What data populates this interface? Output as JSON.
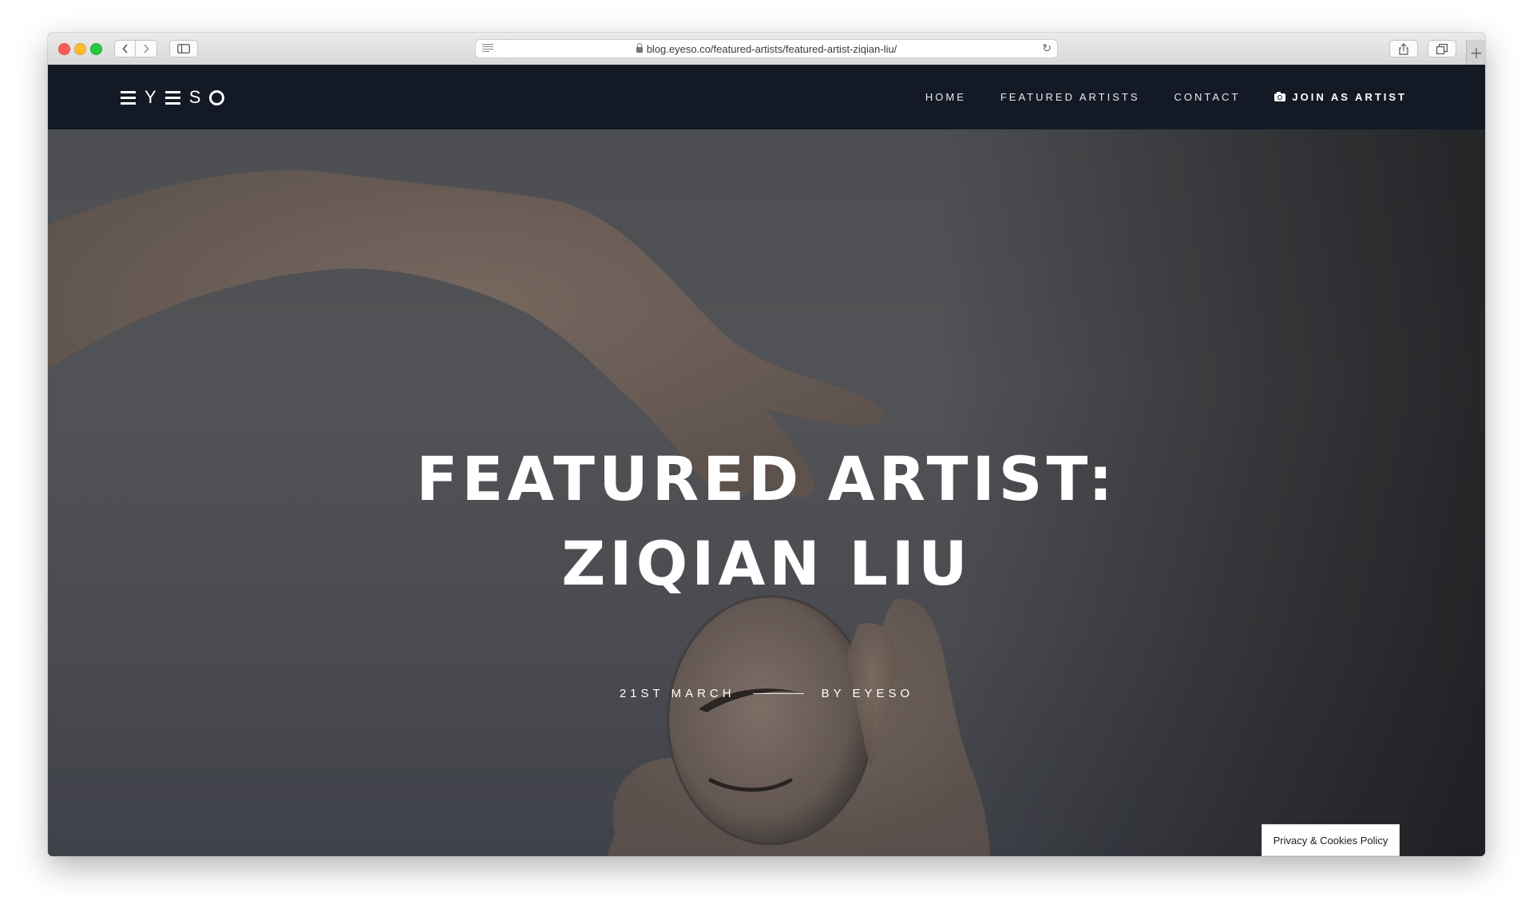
{
  "browser": {
    "url": "blog.eyeso.co/featured-artists/featured-artist-ziqian-liu/",
    "icons": {
      "back": "chevron-left-icon",
      "forward": "chevron-right-icon",
      "sidebar": "sidebar-icon",
      "reader": "reader-icon",
      "lock": "lock-icon",
      "reload": "reload-icon",
      "share": "share-icon",
      "tabs": "tabs-icon",
      "new_tab": "plus-icon"
    }
  },
  "site": {
    "logo_letters": [
      "Y",
      "S"
    ],
    "nav": {
      "home": "HOME",
      "featured_artists": "FEATURED ARTISTS",
      "contact": "CONTACT",
      "join": "JOIN AS ARTIST",
      "join_icon": "camera-icon"
    },
    "colors": {
      "header_bg": "#131a26",
      "text": "#ffffff"
    }
  },
  "hero": {
    "title_line1": "FEATURED ARTIST:",
    "title_line2": "ZIQIAN LIU",
    "date": "21ST MARCH",
    "author": "BY EYESO"
  },
  "privacy": {
    "label": "Privacy & Cookies Policy"
  }
}
